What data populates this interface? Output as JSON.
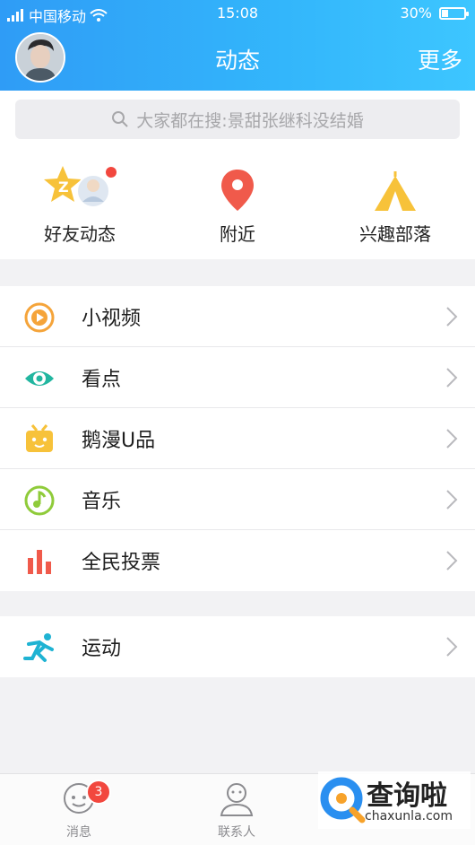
{
  "status_bar": {
    "carrier": "中国移动",
    "time": "15:08",
    "battery": "30%",
    "battery_level": 0.3
  },
  "header": {
    "title": "动态",
    "more": "更多"
  },
  "search": {
    "placeholder": "大家都在搜:景甜张继科没结婚"
  },
  "quick_actions": [
    {
      "label": "好友动态",
      "icon": "friend-feed-icon"
    },
    {
      "label": "附近",
      "icon": "location-pin-icon"
    },
    {
      "label": "兴趣部落",
      "icon": "tent-icon"
    }
  ],
  "list_group_1": [
    {
      "label": "小视频",
      "icon": "play-circle-icon",
      "color": "#f5a43a"
    },
    {
      "label": "看点",
      "icon": "eye-icon",
      "color": "#22b6a0"
    },
    {
      "label": "鹅漫U品",
      "icon": "tv-box-icon",
      "color": "#f7c23a"
    },
    {
      "label": "音乐",
      "icon": "music-note-icon",
      "color": "#8fcb3a"
    },
    {
      "label": "全民投票",
      "icon": "bar-chart-icon",
      "color": "#f05a4b"
    }
  ],
  "list_group_2": [
    {
      "label": "运动",
      "icon": "running-icon",
      "color": "#1fb3d3"
    }
  ],
  "tab_bar": {
    "messages": {
      "label": "消息",
      "badge": "3"
    },
    "contacts": {
      "label": "联系人"
    }
  },
  "watermark": {
    "title": "查询啦",
    "subtitle": "chaxunla.com"
  },
  "colors": {
    "header_start": "#2f9cf6",
    "header_end": "#3dc6ff",
    "badge": "#f2473e"
  }
}
